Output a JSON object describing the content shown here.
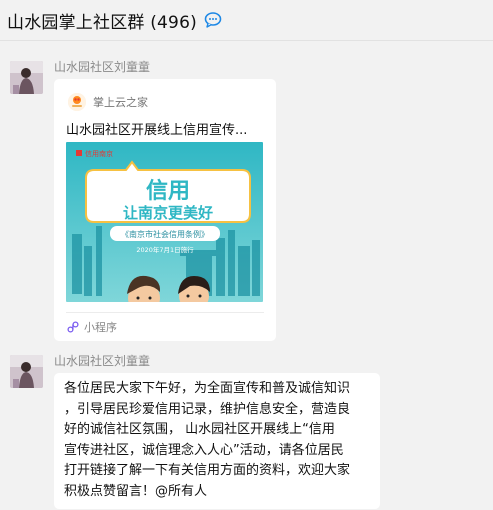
{
  "header": {
    "title": "山水园掌上社区群 (496)"
  },
  "messages": [
    {
      "sender": "山水园社区刘童童",
      "card": {
        "source_name": "掌上云之家",
        "title": "山水园社区开展线上信用宣传...",
        "image": {
          "logo_text": "信用南京",
          "headline": "信用",
          "subheadline": "让南京更美好",
          "banner": "《南京市社会信用条例》",
          "date_text": "2020年7月1日施行"
        },
        "footer_label": "小程序"
      }
    },
    {
      "sender": "山水园社区刘童童",
      "lines": [
        "各位居民大家下午好，为全面宣传和普及诚信知识",
        "，引导居民珍爱信用记录，维护信息安全，营造良",
        "好的诚信社区氛围， 山水园社区开展线上“信用",
        "宣传进社区，诚信理念入人心”活动，请各位居民",
        "打开链接了解一下有关信用方面的资料，欢迎大家",
        "积极点赞留言！@所有人"
      ]
    }
  ],
  "icons": {
    "header_chat": "chat-bubble-icon",
    "card_source": "app-logo-icon",
    "card_footer": "mini-program-icon",
    "avatar": "user-avatar"
  },
  "colors": {
    "background": "#f2f2f2",
    "bubble": "#ffffff",
    "poster_teal": "#2fb7c4",
    "chat_icon": "#1e88e5"
  }
}
